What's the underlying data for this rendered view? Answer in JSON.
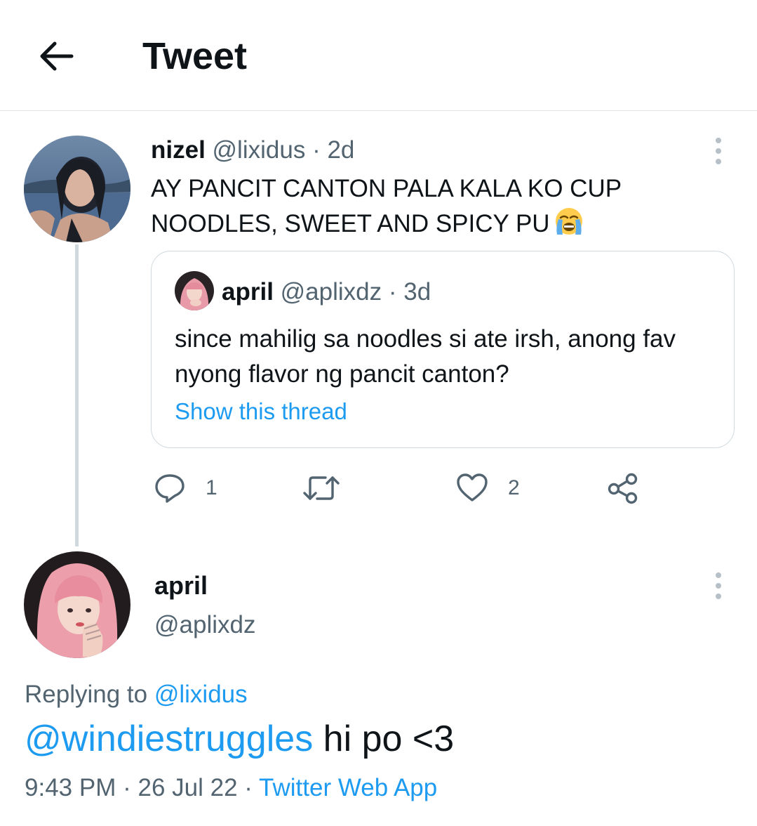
{
  "header": {
    "title": "Tweet",
    "back_icon": "arrow-left-icon"
  },
  "tweet": {
    "name": "nizel",
    "handle": "@lixidus",
    "separator": "·",
    "time": "2d",
    "text": "AY PANCIT CANTON PALA KALA KO CUP NOODLES, SWEET AND SPICY PU",
    "emoji": "loudly-crying-face-emoji",
    "quote": {
      "name": "april",
      "handle": "@aplixdz",
      "separator": "·",
      "time": "3d",
      "text": "since mahilig sa noodles si ate irsh, anong fav nyong flavor ng pancit canton?",
      "show_thread": "Show this thread"
    },
    "actions": {
      "reply_count": "1",
      "retweet_count": "",
      "like_count": "2"
    }
  },
  "reply": {
    "name": "april",
    "handle": "@aplixdz",
    "replying_prefix": "Replying to",
    "replying_to": "@lixidus",
    "mention": "@windiestruggles",
    "text": " hi po <3",
    "time": "9:43 PM",
    "date": "26 Jul 22",
    "separator": "·",
    "source": "Twitter Web App"
  },
  "colors": {
    "accent": "#1d9bf0",
    "muted": "#536471",
    "text": "#0f1419",
    "border": "#cfd9de"
  }
}
